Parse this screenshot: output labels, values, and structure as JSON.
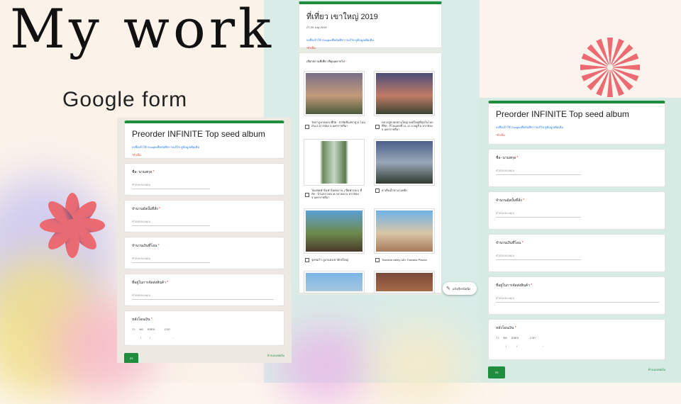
{
  "headline": "My work",
  "subheading": "Google form",
  "colors": {
    "green": "#1e8e3e",
    "flower_pink": "#e8676a",
    "flower_purple": "#5b4a7a"
  },
  "form_left": {
    "title": "Preorder INFINITE Top seed album",
    "signin_note": "ลงชื่อเข้าใช้ Googleเพื่อบันทึกการแก้ไข ดูข้อมูลเพิ่มเติม",
    "required_note": "*จำเป็น",
    "questions": [
      {
        "label": "ชื่อ- นามสกุล",
        "placeholder": "คำตอบของคุณ"
      },
      {
        "label": "จำนวนอัลบั้มที่สั่ง",
        "placeholder": "คำตอบของคุณ"
      },
      {
        "label": "จำนวนเงินที่โอน",
        "placeholder": "คำตอบของคุณ"
      },
      {
        "label": "ที่อยู่ในการจัดส่งสินค้า",
        "placeholder": "คำตอบของคุณ"
      },
      {
        "label": "หลังโอนเงิน",
        "placeholder": ""
      }
    ],
    "date_labels": [
      "วว",
      "ดด",
      "ปปปป",
      "เวลา"
    ],
    "date_values": [
      "/",
      "/",
      ":"
    ],
    "send": "ส่ง",
    "clear": "ล้างแบบฟอร์ม"
  },
  "form_mid": {
    "title": "ที่เที่ยว เขาใหญ่ 2019",
    "date": "27-29 July 2019",
    "signin_note": "ลงชื่อเข้าใช้ Googleเพื่อบันทึกการแก้ไข ดูข้อมูลเพิ่มเติม",
    "required_note": "*จำเป็น",
    "question": "เลือกสถานที่เที่ยว ที่คุณอยากไป",
    "options": [
      "วัดป่าภูหายหลง ที่กัด : ป่ายัดชีแสทาสู่ ต.โนนเงิน อ.ปากช่อง จ.นครราชสีมา",
      "หลวงปู่ทวดสยามใหญ่ องค์ใหญ่ที่สุดในโลก ที่กัด : กิโลเมตรที่ 11-12 ถ.หมูสี อ.ปากช่อง จ.นครราชสีมา",
      "ไอแซคฟาร์มฟาร์มคนงาน ( ขืตฟารอง ) ที่กัด : บ้านกลางดง ต.กลางดง อ.ปากช่อง จ.นครราชสีมา",
      "ฮาเท็นน้ำชานามพยิ่ง",
      "จุดชมวิว ภูผาแดงเขายักษ์ใหญ่",
      "Toscana valley และ Toscana Piazza"
    ],
    "edit_fab": "แจ้งเรียกนิดนึง"
  },
  "form_right": {
    "title": "Preorder INFINITE Top seed album",
    "signin_note": "ลงชื่อเข้าใช้ Googleเพื่อบันทึกการแก้ไข ดูข้อมูลเพิ่มเติม",
    "required_note": "*จำเป็น",
    "questions": [
      {
        "label": "ชื่อ- นามสกุล",
        "placeholder": "คำตอบของคุณ"
      },
      {
        "label": "จำนวนอัลบั้มที่สั่ง",
        "placeholder": "คำตอบของคุณ"
      },
      {
        "label": "จำนวนเงินที่โอน",
        "placeholder": "คำตอบของคุณ"
      },
      {
        "label": "ที่อยู่ในการจัดส่งสินค้า",
        "placeholder": "คำตอบของคุณ"
      },
      {
        "label": "หลังโอนเงิน",
        "placeholder": ""
      }
    ],
    "date_labels": [
      "วว",
      "ดด",
      "ปปปป",
      "เวลา"
    ],
    "date_values": [
      "/",
      "/",
      ":"
    ],
    "send": "ส่ง",
    "clear": "ล้างแบบฟอร์ม"
  }
}
